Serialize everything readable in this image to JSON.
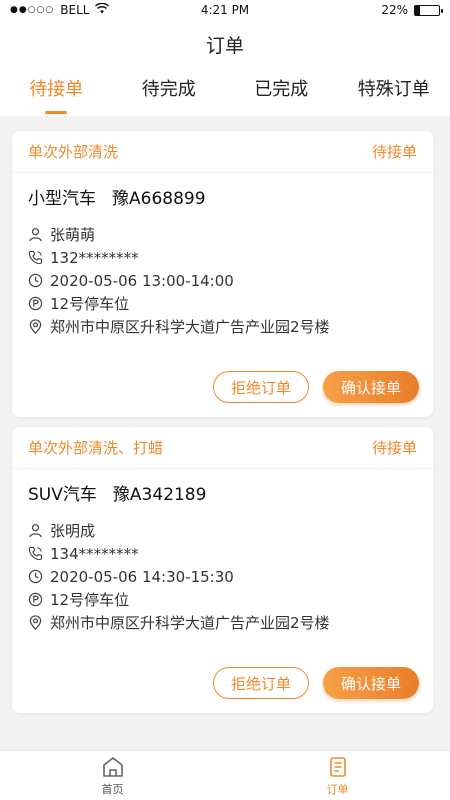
{
  "status_bar": {
    "carrier": "BELL",
    "time": "4:21 PM",
    "battery": "22%",
    "battery_level": 0.22
  },
  "nav": {
    "title": "订单"
  },
  "tabs": [
    {
      "label": "待接单",
      "active": true
    },
    {
      "label": "待完成",
      "active": false
    },
    {
      "label": "已完成",
      "active": false
    },
    {
      "label": "特殊订单",
      "active": false
    }
  ],
  "orders": [
    {
      "service": "单次外部清洗",
      "status": "待接单",
      "vehicle_type": "小型汽车",
      "plate": "豫A668899",
      "name": "张萌萌",
      "phone": "132********",
      "datetime": "2020-05-06  13:00-14:00",
      "parking": "12号停车位",
      "address": "郑州市中原区升科学大道广告产业园2号楼",
      "reject_label": "拒绝订单",
      "accept_label": "确认接单"
    },
    {
      "service": "单次外部清洗、打蜡",
      "status": "待接单",
      "vehicle_type": "SUV汽车",
      "plate": "豫A342189",
      "name": "张明成",
      "phone": "134********",
      "datetime": "2020-05-06  14:30-15:30",
      "parking": "12号停车位",
      "address": "郑州市中原区升科学大道广告产业园2号楼",
      "reject_label": "拒绝订单",
      "accept_label": "确认接单"
    }
  ],
  "tabbar": [
    {
      "label": "首页",
      "icon": "home-icon",
      "active": false
    },
    {
      "label": "订单",
      "icon": "order-list-icon",
      "active": true
    }
  ],
  "colors": {
    "accent": "#ef8a2b",
    "background": "#f3f3f3"
  }
}
